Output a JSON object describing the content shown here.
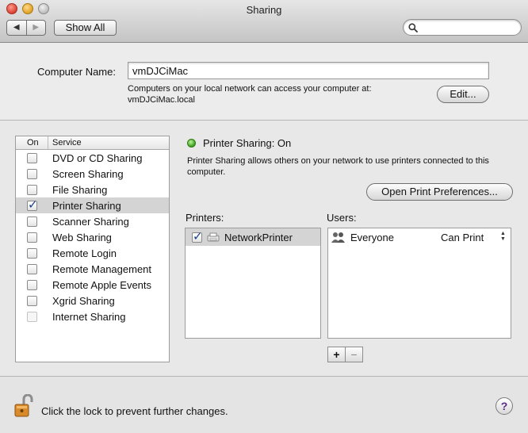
{
  "window": {
    "title": "Sharing"
  },
  "toolbar": {
    "back_glyph": "◀",
    "forward_glyph": "▶",
    "show_all_label": "Show All",
    "search_placeholder": ""
  },
  "computer": {
    "name_label": "Computer Name:",
    "name_value": "vmDJCiMac",
    "access_line1": "Computers on your local network can access your computer at:",
    "access_line2": "vmDJCiMac.local",
    "edit_label": "Edit..."
  },
  "services": {
    "header_on": "On",
    "header_service": "Service",
    "items": [
      {
        "name": "DVD or CD Sharing",
        "checked": false
      },
      {
        "name": "Screen Sharing",
        "checked": false
      },
      {
        "name": "File Sharing",
        "checked": false
      },
      {
        "name": "Printer Sharing",
        "checked": true,
        "selected": true
      },
      {
        "name": "Scanner Sharing",
        "checked": false
      },
      {
        "name": "Web Sharing",
        "checked": false
      },
      {
        "name": "Remote Login",
        "checked": false
      },
      {
        "name": "Remote Management",
        "checked": false
      },
      {
        "name": "Remote Apple Events",
        "checked": false
      },
      {
        "name": "Xgrid Sharing",
        "checked": false
      },
      {
        "name": "Internet Sharing",
        "checked": false,
        "disabled": true
      }
    ]
  },
  "detail": {
    "status": "Printer Sharing: On",
    "status_color": "#3d9e1c",
    "description": "Printer Sharing allows others on your network to use printers connected to this computer.",
    "open_prefs_label": "Open Print Preferences...",
    "printers_label": "Printers:",
    "users_label": "Users:",
    "printers": [
      {
        "name": "NetworkPrinter",
        "checked": true,
        "icon": "printer-icon"
      }
    ],
    "users": [
      {
        "name": "Everyone",
        "permission": "Can Print",
        "icon": "group-icon"
      }
    ],
    "add_label": "+",
    "remove_label": "−"
  },
  "footer": {
    "lock_text": "Click the lock to prevent further changes.",
    "help_label": "?"
  }
}
